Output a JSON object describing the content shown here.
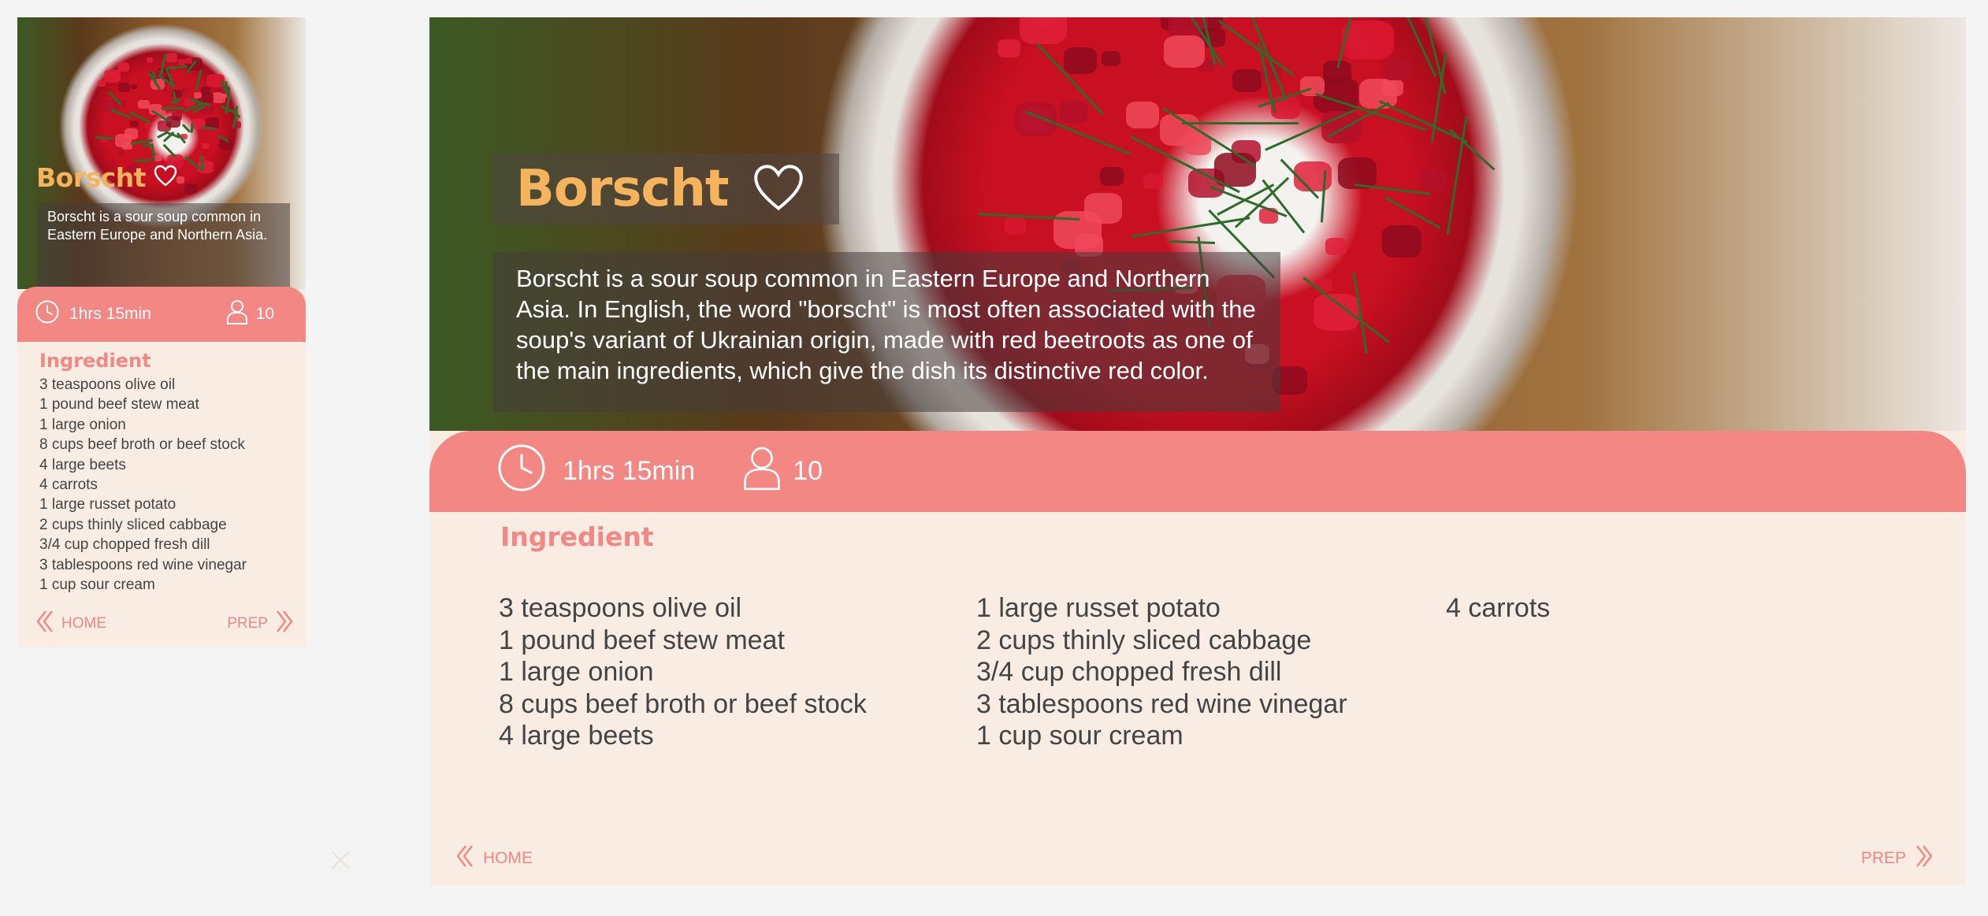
{
  "recipe": {
    "title": "Borscht",
    "description_short": "Borscht is a sour soup common in Eastern Europe and Northern Asia.",
    "description_full": "Borscht is a sour soup common in Eastern Europe and Northern Asia. In English, the word \"borscht\" is most often associated with the soup's variant of Ukrainian origin, made with red beetroots as one of the main ingredients, which give the dish its distinctive red color.",
    "time": "1hrs 15min",
    "servings": "10",
    "ingredient_heading": "Ingredient",
    "ingredients": [
      "3 teaspoons olive oil",
      "1 pound beef stew meat",
      "1 large onion",
      "8 cups beef broth or beef stock",
      "4 large beets",
      "4 carrots",
      "1 large russet potato",
      "2 cups thinly sliced cabbage",
      "3/4 cup chopped fresh dill",
      "3 tablespoons red wine vinegar",
      "1 cup sour cream"
    ],
    "ingredient_columns": [
      [
        "3 teaspoons olive oil",
        "1 pound beef stew meat",
        "1 large onion",
        "8 cups beef broth or beef stock",
        "4 large beets"
      ],
      [
        "1 large russet potato",
        "2 cups thinly sliced cabbage",
        "3/4 cup chopped fresh dill",
        "3 tablespoons red wine vinegar",
        "1 cup sour cream"
      ],
      [
        "4 carrots"
      ]
    ]
  },
  "nav": {
    "home_label": "HOME",
    "prep_label": "PREP"
  },
  "icons": {
    "favorite": "heart-icon",
    "time": "clock-icon",
    "servings": "person-icon",
    "back": "chevron-left-icon",
    "next": "chevron-right-icon",
    "close": "close-icon"
  },
  "colors": {
    "accent": "#f28783",
    "title": "#f5b45c",
    "card_background": "#f8ece3",
    "page_background": "#f4f4f4",
    "text": "#444444"
  }
}
